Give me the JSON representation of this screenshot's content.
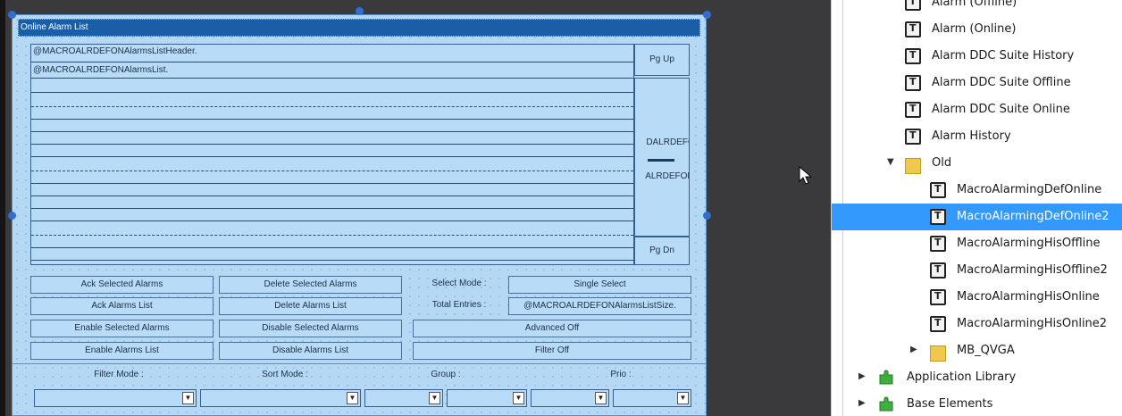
{
  "designer": {
    "title": "Online Alarm List",
    "list_header": "@MACROALRDEFONAlarmsListHeader.",
    "list_first_row": "@MACROALRDEFONAlarmsList.",
    "pg_up": "Pg Up",
    "pg_dn": "Pg Dn",
    "scroll_text_1": "DALRDEFON",
    "scroll_text_2": "ALRDEFONM",
    "buttons": {
      "ack_selected": "Ack Selected Alarms",
      "delete_selected": "Delete Selected Alarms",
      "select_mode_label": "Select Mode :",
      "single_select": "Single Select",
      "ack_list": "Ack Alarms List",
      "delete_list": "Delete Alarms List",
      "total_entries_label": "Total Entries :",
      "list_size": "@MACROALRDEFONAlarmsListSize.",
      "enable_selected": "Enable Selected Alarms",
      "disable_selected": "Disable Selected Alarms",
      "advanced_off": "Advanced Off",
      "enable_list": "Enable Alarms List",
      "disable_list": "Disable Alarms List",
      "filter_off": "Filter Off"
    },
    "filters": {
      "filter_mode": "Filter Mode :",
      "sort_mode": "Sort Mode :",
      "group": "Group :",
      "prio": "Prio :"
    }
  },
  "tree": {
    "items": [
      {
        "label": "Alarm (Offline)",
        "icon": "template-icon"
      },
      {
        "label": "Alarm (Online)",
        "icon": "template-icon"
      },
      {
        "label": "Alarm DDC Suite History",
        "icon": "template-icon"
      },
      {
        "label": "Alarm DDC Suite Offline",
        "icon": "template-icon"
      },
      {
        "label": "Alarm DDC Suite Online",
        "icon": "template-icon"
      },
      {
        "label": "Alarm History",
        "icon": "template-icon"
      },
      {
        "label": "Old",
        "icon": "folder-icon"
      },
      {
        "label": "MacroAlarmingDefOnline",
        "icon": "template-icon"
      },
      {
        "label": "MacroAlarmingDefOnline2",
        "icon": "template-icon"
      },
      {
        "label": "MacroAlarmingHisOffline",
        "icon": "template-icon"
      },
      {
        "label": "MacroAlarmingHisOffline2",
        "icon": "template-icon"
      },
      {
        "label": "MacroAlarmingHisOnline",
        "icon": "template-icon"
      },
      {
        "label": "MacroAlarmingHisOnline2",
        "icon": "template-icon"
      },
      {
        "label": "MB_QVGA",
        "icon": "folder-icon"
      },
      {
        "label": "Application Library",
        "icon": "puzzle-icon"
      },
      {
        "label": "Base Elements",
        "icon": "puzzle-icon"
      }
    ],
    "selected": "MacroAlarmingDefOnline2",
    "colors": {
      "selection": "#3399ff"
    }
  }
}
